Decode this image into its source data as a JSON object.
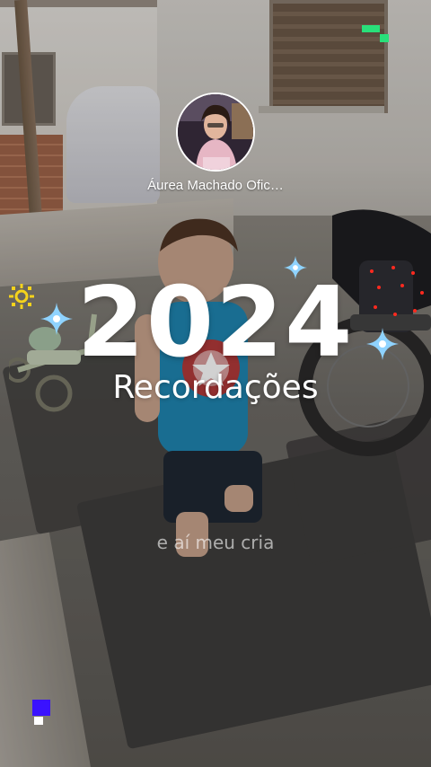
{
  "story": {
    "account_name": "Áurea Machado Ofic…",
    "year_title": "2024",
    "subtitle": "Recordações",
    "caption": "e aí meu cria"
  },
  "icons": {
    "avatar": "profile-photo",
    "sparkles": [
      "sparkle-icon",
      "sun-icon",
      "dots-icon"
    ],
    "brand_marks": [
      "top-right-mark",
      "bottom-left-mark"
    ]
  },
  "colors": {
    "text": "#ffffff",
    "sparkle_blue": "#8fd3ff",
    "sun_yellow": "#f5d31c",
    "dots_red": "#ff2a1f",
    "mark_green": "#29e07a",
    "mark_purple": "#3a12ff"
  }
}
